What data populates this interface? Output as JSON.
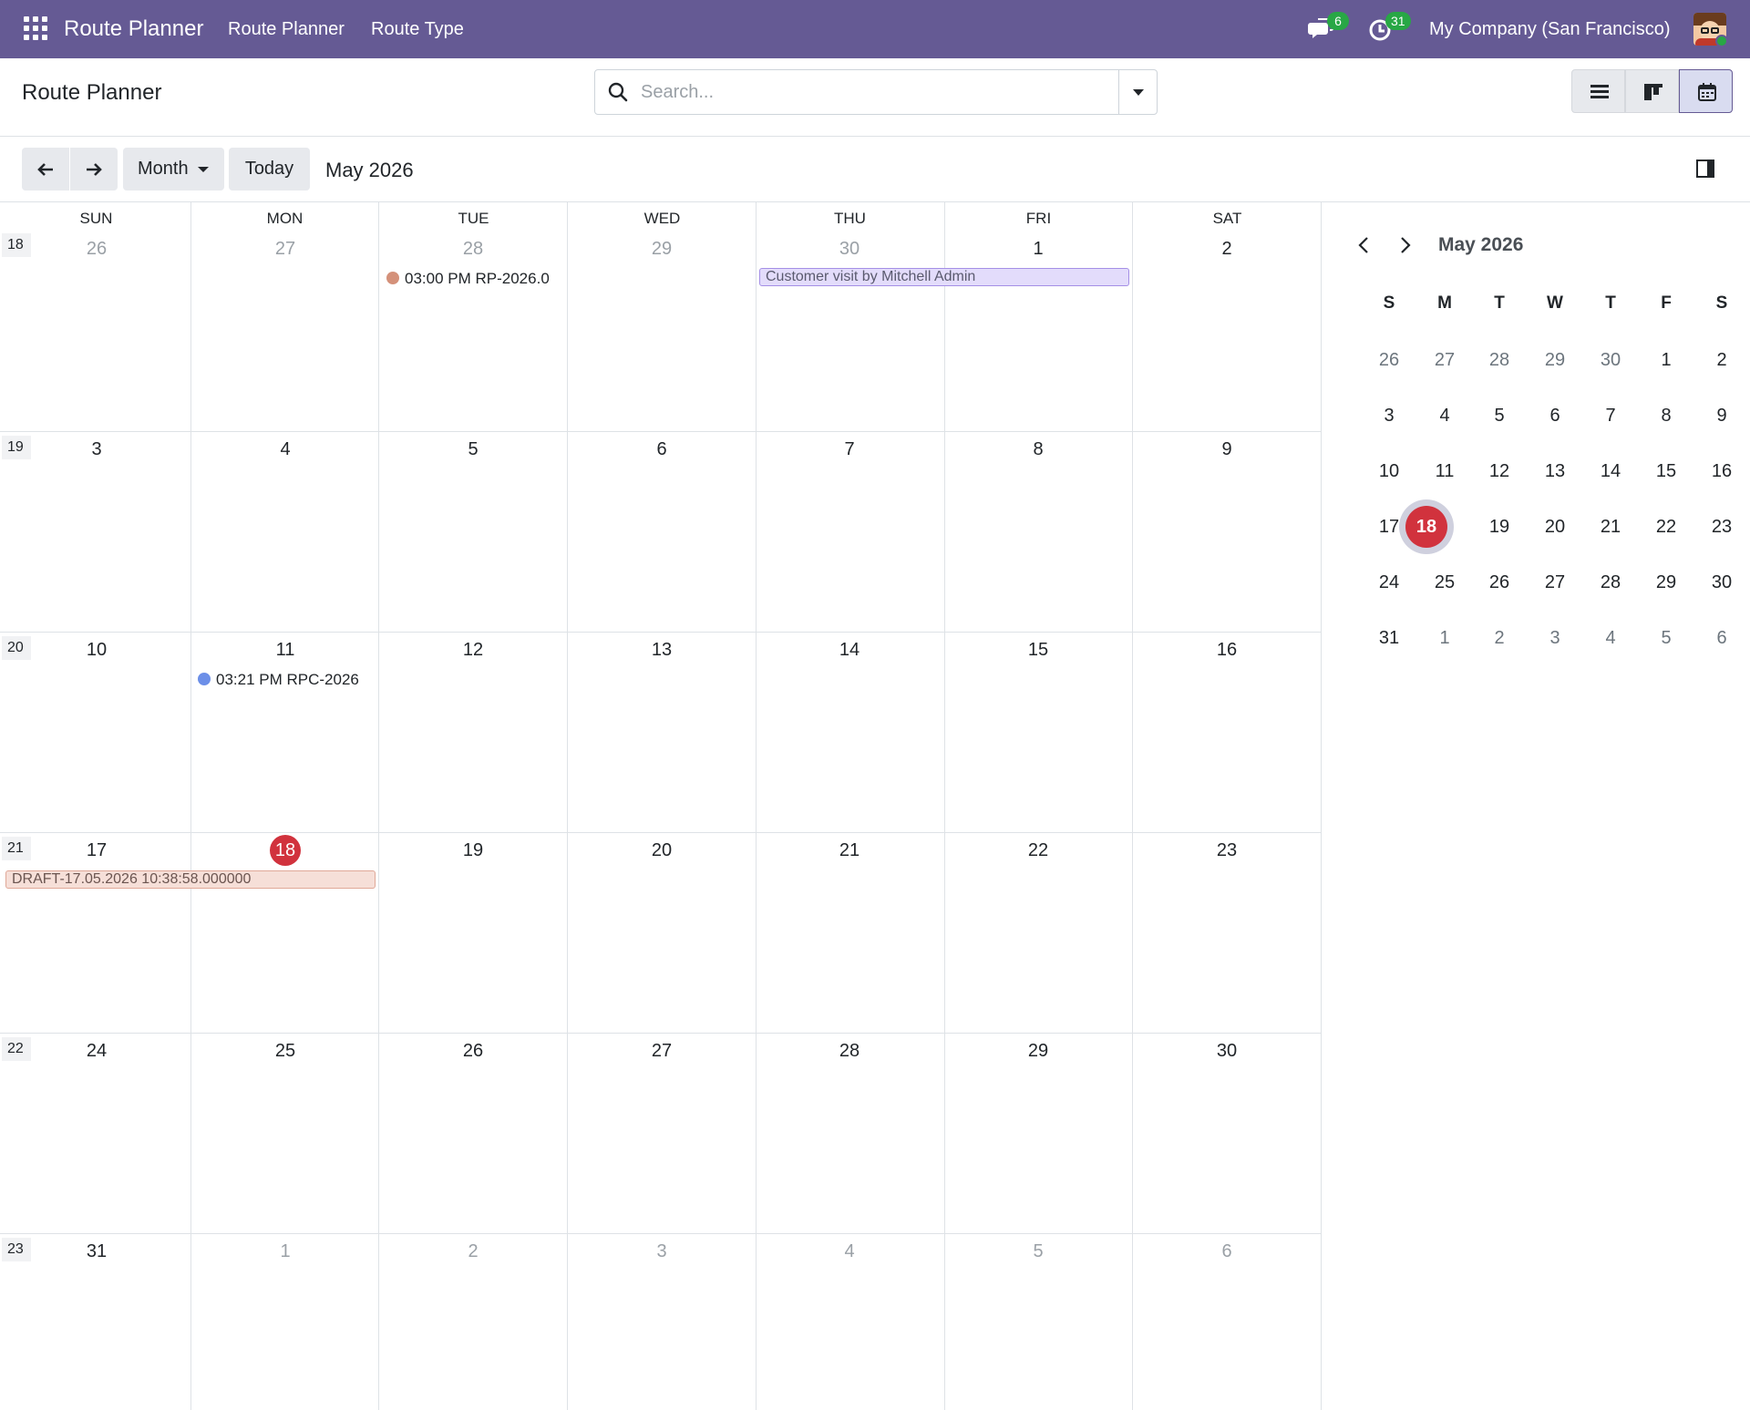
{
  "navbar": {
    "app_name": "Route Planner",
    "menus": [
      "Route Planner",
      "Route Type"
    ],
    "messages_count": "6",
    "activities_count": "31",
    "company": "My Company (San Francisco)",
    "bg_color": "#655a94",
    "badge_color": "#28a745"
  },
  "control": {
    "breadcrumb": "Route Planner",
    "search_placeholder": "Search...",
    "views": [
      "list-view-icon",
      "kanban-view-icon",
      "calendar-view-icon"
    ],
    "active_view": "calendar"
  },
  "toolbar": {
    "scale_label": "Month",
    "today_label": "Today",
    "period_title": "May 2026"
  },
  "calendar": {
    "weekdays": [
      "SUN",
      "MON",
      "TUE",
      "WED",
      "THU",
      "FRI",
      "SAT"
    ],
    "weeks": [
      {
        "number": "18",
        "days": [
          "26",
          "27",
          "28",
          "29",
          "30",
          "1",
          "2"
        ]
      },
      {
        "number": "19",
        "days": [
          "3",
          "4",
          "5",
          "6",
          "7",
          "8",
          "9"
        ]
      },
      {
        "number": "20",
        "days": [
          "10",
          "11",
          "12",
          "13",
          "14",
          "15",
          "16"
        ]
      },
      {
        "number": "21",
        "days": [
          "17",
          "18",
          "19",
          "20",
          "21",
          "22",
          "23"
        ]
      },
      {
        "number": "22",
        "days": [
          "24",
          "25",
          "26",
          "27",
          "28",
          "29",
          "30"
        ]
      },
      {
        "number": "23",
        "days": [
          "31",
          "1",
          "2",
          "3",
          "4",
          "5",
          "6"
        ]
      }
    ],
    "today": "18",
    "events": {
      "rp": {
        "time": "03:00 PM",
        "title": "RP-2026.0",
        "color": "#d4917a"
      },
      "visit": {
        "title": "Customer visit by Mitchell Admin",
        "color": "#e3dcfb",
        "border": "#a48fe6"
      },
      "rpc": {
        "time": "03:21 PM",
        "title": "RPC-2026",
        "color": "#6c8fe8"
      },
      "draft": {
        "title": "DRAFT-17.05.2026 10:38:58.000000",
        "color": "#f6dfd8",
        "border": "#e0a898"
      }
    }
  },
  "mini": {
    "title": "May 2026",
    "weekdays": [
      "S",
      "M",
      "T",
      "W",
      "T",
      "F",
      "S"
    ],
    "weeks": [
      [
        "26",
        "27",
        "28",
        "29",
        "30",
        "1",
        "2"
      ],
      [
        "3",
        "4",
        "5",
        "6",
        "7",
        "8",
        "9"
      ],
      [
        "10",
        "11",
        "12",
        "13",
        "14",
        "15",
        "16"
      ],
      [
        "17",
        "18",
        "19",
        "20",
        "21",
        "22",
        "23"
      ],
      [
        "24",
        "25",
        "26",
        "27",
        "28",
        "29",
        "30"
      ],
      [
        "31",
        "1",
        "2",
        "3",
        "4",
        "5",
        "6"
      ]
    ],
    "today_color": "#d1323d"
  }
}
